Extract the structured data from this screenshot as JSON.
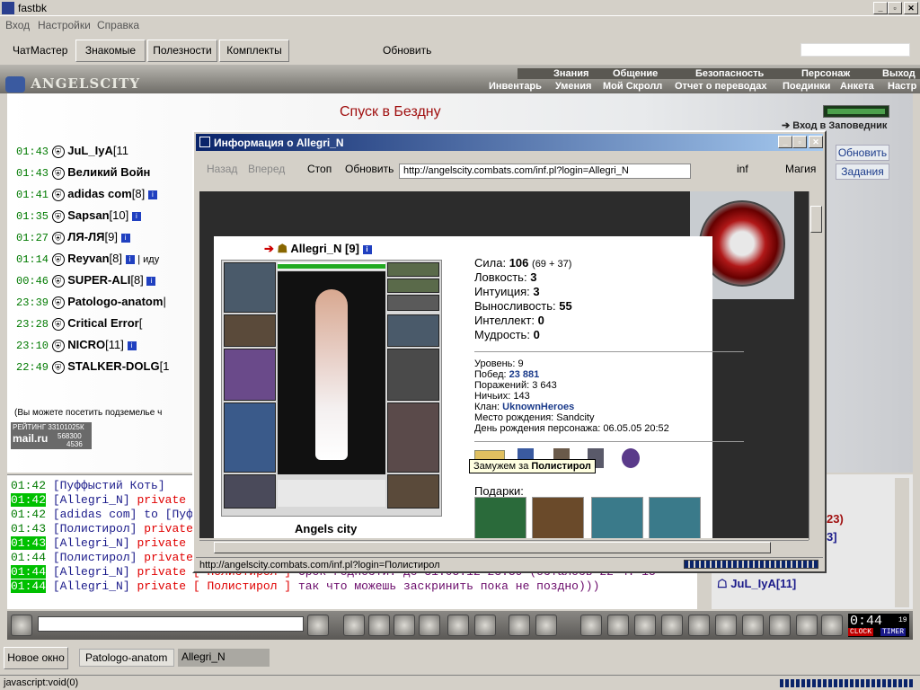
{
  "window": {
    "title": "fastbk"
  },
  "menu": [
    "Вход",
    "Настройки",
    "Справка"
  ],
  "toolbar": {
    "chatmaster": "ЧатМастер",
    "buttons": [
      "Знакомые",
      "Полезности",
      "Комплекты"
    ],
    "refresh": "Обновить"
  },
  "game": {
    "logo": "ANGELSCITY",
    "nav_top": [
      "Знания",
      "Общение",
      "Безопасность",
      "Персонаж",
      "Выход"
    ],
    "nav_sub": [
      "Инвентарь",
      "Умения",
      "Мой Скролл",
      "Отчет о переводах",
      "Поединки",
      "Анкета",
      "Настр"
    ],
    "room_title": "Спуск в Бездну",
    "enter_label": "Вход в Заповедник",
    "side_buttons": [
      "Обновить",
      "Задания"
    ],
    "visit_note": "(Вы можете посетить подземелье ч",
    "counter": {
      "line1": "РЕЙТИНГ 33101025К",
      "line2": "mail.ru",
      "line3": "568300",
      "line4": "4536"
    }
  },
  "online": [
    {
      "time": "01:43",
      "name": "JuL_IyA",
      "extra": "[11"
    },
    {
      "time": "01:43",
      "name": "Великий Войн",
      "extra": ""
    },
    {
      "time": "01:41",
      "name": "adidas com",
      "extra": "[8]"
    },
    {
      "time": "01:35",
      "name": "Sapsan",
      "extra": "[10]"
    },
    {
      "time": "01:27",
      "name": "ЛЯ-ЛЯ",
      "extra": "[9]"
    },
    {
      "time": "01:14",
      "name": "Reyvan",
      "extra": "[8]",
      "note": "| иду"
    },
    {
      "time": "00:46",
      "name": "SUPER-ALI",
      "extra": "[8]"
    },
    {
      "time": "23:39",
      "name": "Patologo-anatom",
      "extra": "|"
    },
    {
      "time": "23:28",
      "name": "Critical Error",
      "extra": "["
    },
    {
      "time": "23:10",
      "name": "NICRO",
      "extra": "[11]"
    },
    {
      "time": "22:49",
      "name": "STALKER-DOLG",
      "extra": "[1"
    }
  ],
  "chat": [
    {
      "time": "01:42",
      "hl": false,
      "name": "[Пуффыстий Коть]",
      "priv": "",
      "to": "",
      "text": ""
    },
    {
      "time": "01:42",
      "hl": true,
      "name": "[Allegri_N]",
      "priv": "private [ Г",
      "to": "",
      "text": ""
    },
    {
      "time": "01:42",
      "hl": false,
      "name": "[adidas com]",
      "priv": "",
      "to": "to [Пуф",
      "text": ""
    },
    {
      "time": "01:43",
      "hl": false,
      "name": "[Полистирол]",
      "priv": "private",
      "to": "",
      "text": ""
    },
    {
      "time": "01:43",
      "hl": true,
      "name": "[Allegri_N]",
      "priv": "private",
      "to": "",
      "text": ""
    },
    {
      "time": "01:44",
      "hl": false,
      "name": "[Полистирол]",
      "priv": "private",
      "to": "",
      "text": ""
    },
    {
      "time": "01:44",
      "hl": true,
      "name": "[Allegri_N]",
      "priv": "private [ Полистирол ]",
      "to": "",
      "text": "Срок годности: до 31.05.12 23:59 (осталось 22 ч. 15"
    },
    {
      "time": "01:44",
      "hl": true,
      "name": "[Allegri_N]",
      "priv": "private [ Полистирол ]",
      "to": "",
      "text": "так что можешь заскринить пока не поздно)))"
    }
  ],
  "right_list": {
    "item1": "23)",
    "item2": "3]",
    "item3": "JuL_IyA[11]"
  },
  "clock": {
    "time": "0:44",
    "seconds": "19",
    "label1": "CLOCK",
    "label2": "TIMER"
  },
  "taskbar": {
    "new_window": "Новое окно",
    "tabs": [
      "Patologo-anatom",
      "Allegri_N"
    ]
  },
  "statusbar": "javascript:void(0)",
  "popup": {
    "title": "Информация о Allegri_N",
    "nav": [
      "Назад",
      "Вперед",
      "Стоп",
      "Обновить"
    ],
    "url": "http://angelscity.combats.com/inf.pl?login=Allegri_N",
    "right_links": [
      "inf",
      "Магия"
    ],
    "status": "http://angelscity.combats.com/inf.pl?login=Полистирол",
    "char": {
      "name": "Allegri_N",
      "level_tag": "[9]",
      "city": "Angels city"
    },
    "stats": [
      {
        "label": "Сила:",
        "value": "106",
        "extra": "(69 + 37)"
      },
      {
        "label": "Ловкость:",
        "value": "3",
        "extra": ""
      },
      {
        "label": "Интуиция:",
        "value": "3",
        "extra": ""
      },
      {
        "label": "Выносливость:",
        "value": "55",
        "extra": ""
      },
      {
        "label": "Интеллект:",
        "value": "0",
        "extra": ""
      },
      {
        "label": "Мудрость:",
        "value": "0",
        "extra": ""
      }
    ],
    "info": [
      {
        "label": "Уровень:",
        "value": "9"
      },
      {
        "label": "Побед:",
        "value": "23 881"
      },
      {
        "label": "Поражений:",
        "value": "3 643"
      },
      {
        "label": "Ничьих:",
        "value": "143"
      },
      {
        "label": "Клан:",
        "value": "UknownHeroes"
      },
      {
        "label": "Место рождения:",
        "value": "Sandcity"
      },
      {
        "label": "День рождения персонажа:",
        "value": "06.05.05 20:52"
      }
    ],
    "tooltip": {
      "prefix": "Замужем за",
      "name": "Полистирол"
    },
    "gifts_label": "Подарки:"
  }
}
